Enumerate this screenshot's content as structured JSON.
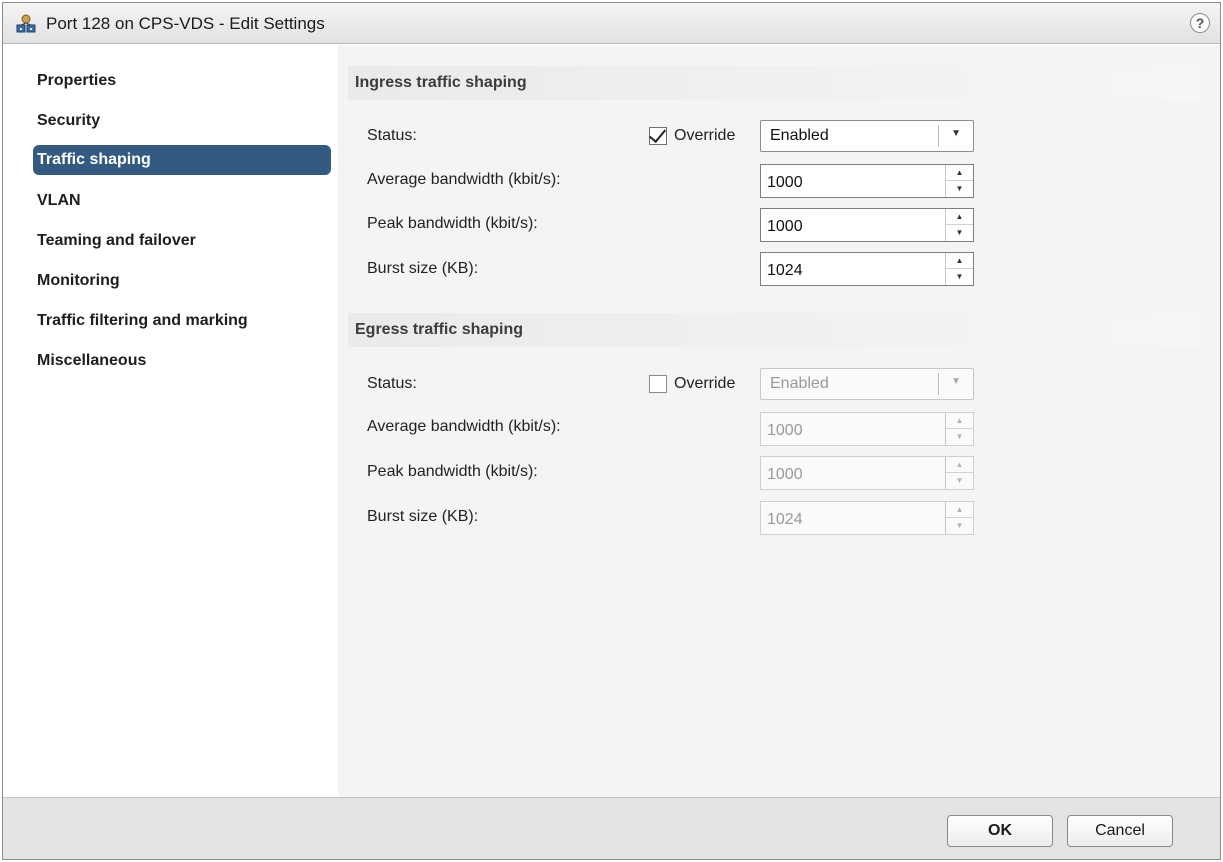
{
  "window": {
    "title": "Port 128 on CPS-VDS - Edit Settings",
    "icon": "network-port-icon",
    "help_label": "?"
  },
  "sidebar": {
    "items": [
      {
        "label": "Properties",
        "selected": false
      },
      {
        "label": "Security",
        "selected": false
      },
      {
        "label": "Traffic shaping",
        "selected": true
      },
      {
        "label": "VLAN",
        "selected": false
      },
      {
        "label": "Teaming and failover",
        "selected": false
      },
      {
        "label": "Monitoring",
        "selected": false
      },
      {
        "label": "Traffic filtering and marking",
        "selected": false
      },
      {
        "label": "Miscellaneous",
        "selected": false
      }
    ],
    "selected_color": "#335b82"
  },
  "ingress": {
    "header": "Ingress traffic shaping",
    "status_label": "Status:",
    "override_label": "Override",
    "override_checked": true,
    "status_value": "Enabled",
    "avg_label": "Average bandwidth (kbit/s):",
    "avg_value": "1000",
    "peak_label": "Peak bandwidth (kbit/s):",
    "peak_value": "1000",
    "burst_label": "Burst size (KB):",
    "burst_value": "1024"
  },
  "egress": {
    "header": "Egress traffic shaping",
    "status_label": "Status:",
    "override_label": "Override",
    "override_checked": false,
    "status_value": "Enabled",
    "avg_label": "Average bandwidth (kbit/s):",
    "avg_value": "1000",
    "peak_label": "Peak bandwidth (kbit/s):",
    "peak_value": "1000",
    "burst_label": "Burst size (KB):",
    "burst_value": "1024"
  },
  "footer": {
    "ok_label": "OK",
    "cancel_label": "Cancel"
  }
}
